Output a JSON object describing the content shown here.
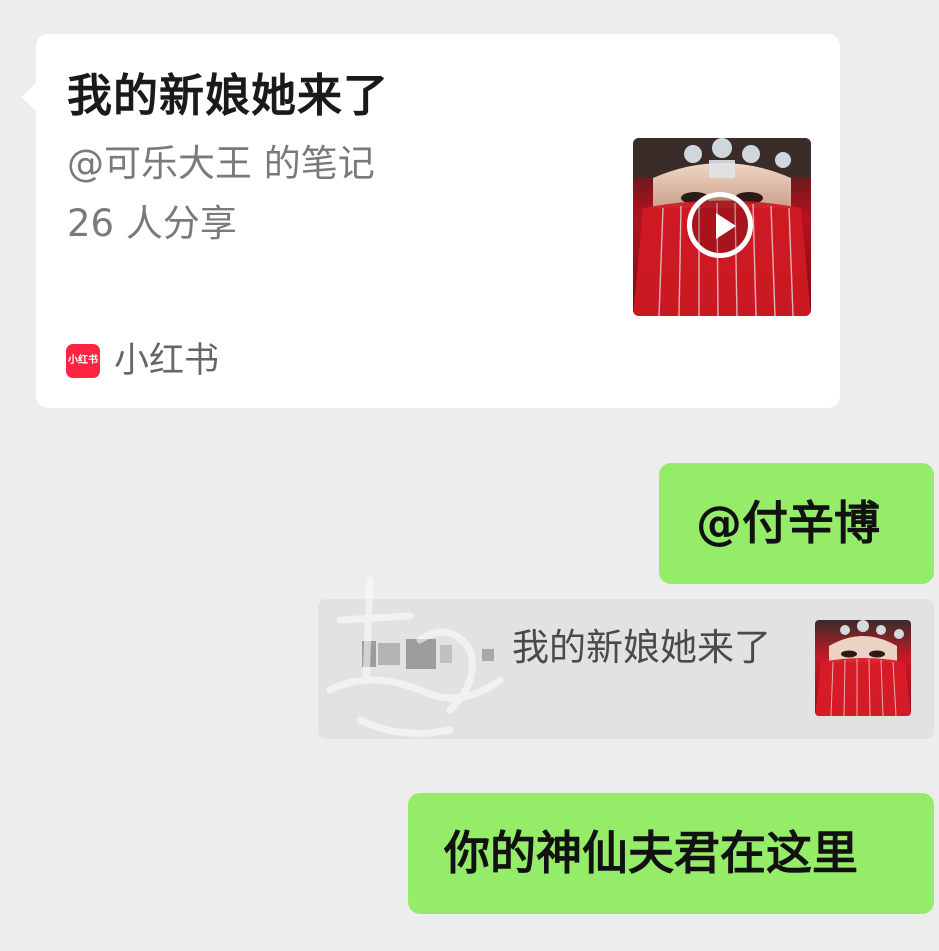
{
  "shared_card": {
    "title": "我的新娘她来了",
    "author": "@可乐大王 的笔记",
    "shares": "26 人分享",
    "source_logo_text": "小红书",
    "source_name": "小红书",
    "thumbnail_icon": "play-icon"
  },
  "messages": {
    "mention": "@付辛博",
    "quote_text": "我的新娘她来了",
    "reply": "你的神仙夫君在这里"
  },
  "colors": {
    "background": "#ededed",
    "bubble_green": "#95ec69",
    "card_white": "#ffffff",
    "quote_gray": "#e2e2e2",
    "brand_red": "#ff2442"
  }
}
